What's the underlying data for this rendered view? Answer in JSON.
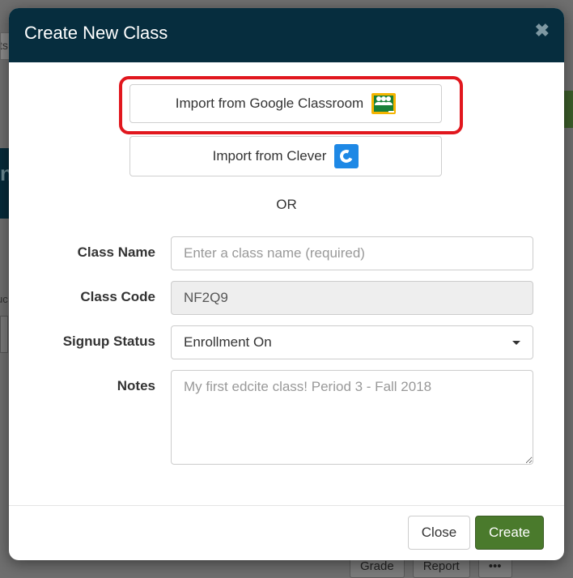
{
  "background": {
    "left_input_text": "ts",
    "left_heading_char": "n",
    "left_label_text": "uc",
    "bottom_buttons": [
      "Grade",
      "Report",
      "•••"
    ]
  },
  "modal": {
    "title": "Create New Class",
    "close_glyph": "✖",
    "import_google_label": "Import from Google Classroom",
    "import_clever_label": "Import from Clever",
    "or_text": "OR",
    "form": {
      "class_name_label": "Class Name",
      "class_name_value": "",
      "class_name_placeholder": "Enter a class name (required)",
      "class_code_label": "Class Code",
      "class_code_value": "NF2Q9",
      "signup_status_label": "Signup Status",
      "signup_status_value": "Enrollment On",
      "notes_label": "Notes",
      "notes_value": "",
      "notes_placeholder": "My first edcite class! Period 3 - Fall 2018"
    },
    "footer": {
      "close_label": "Close",
      "create_label": "Create"
    }
  },
  "colors": {
    "header_bg": "#062d3e",
    "create_button": "#4a7a2c",
    "highlight": "#e1171e"
  }
}
